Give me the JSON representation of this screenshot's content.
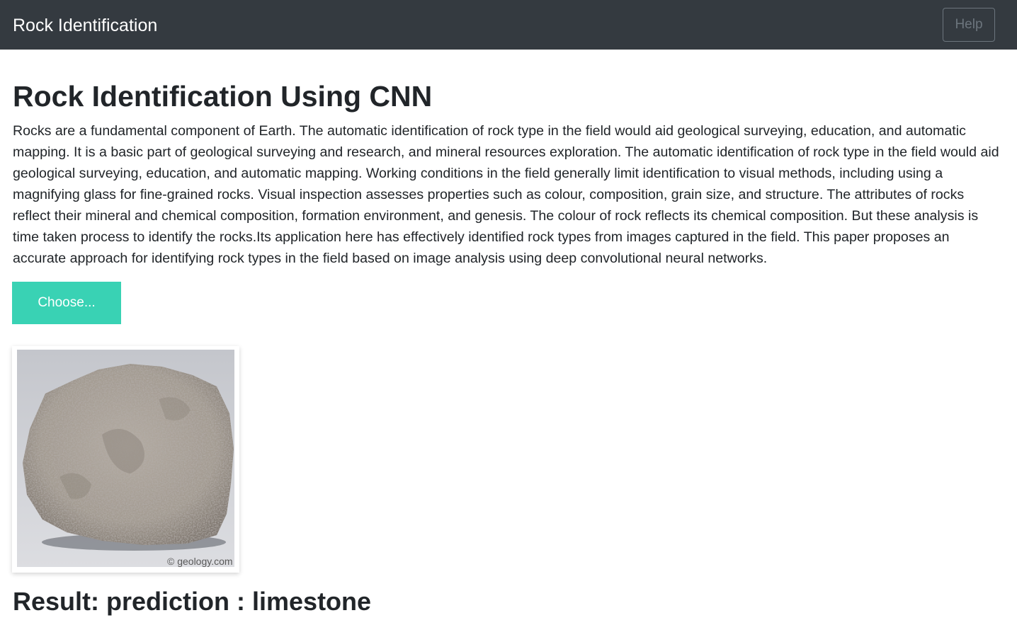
{
  "navbar": {
    "brand": "Rock Identification",
    "help_label": "Help"
  },
  "main": {
    "title": "Rock Identification Using CNN",
    "description": "Rocks are a fundamental component of Earth. The automatic identification of rock type in the field would aid geological surveying, education, and automatic mapping. It is a basic part of geological surveying and research, and mineral resources exploration. The automatic identification of rock type in the field would aid geological surveying, education, and automatic mapping. Working conditions in the field generally limit identification to visual methods, including using a magnifying glass for fine-grained rocks. Visual inspection assesses properties such as colour, composition, grain size, and structure. The attributes of rocks reflect their mineral and chemical composition, formation environment, and genesis. The colour of rock reflects its chemical composition. But these analysis is time taken process to identify the rocks.Its application here has effectively identified rock types from images captured in the field. This paper proposes an accurate approach for identifying rock types in the field based on image analysis using deep convolutional neural networks.",
    "choose_label": "Choose...",
    "image_watermark": "© geology.com",
    "result": "Result: prediction : limestone"
  },
  "colors": {
    "navbar_bg": "#343a40",
    "accent": "#39d2b4",
    "text": "#212529"
  }
}
